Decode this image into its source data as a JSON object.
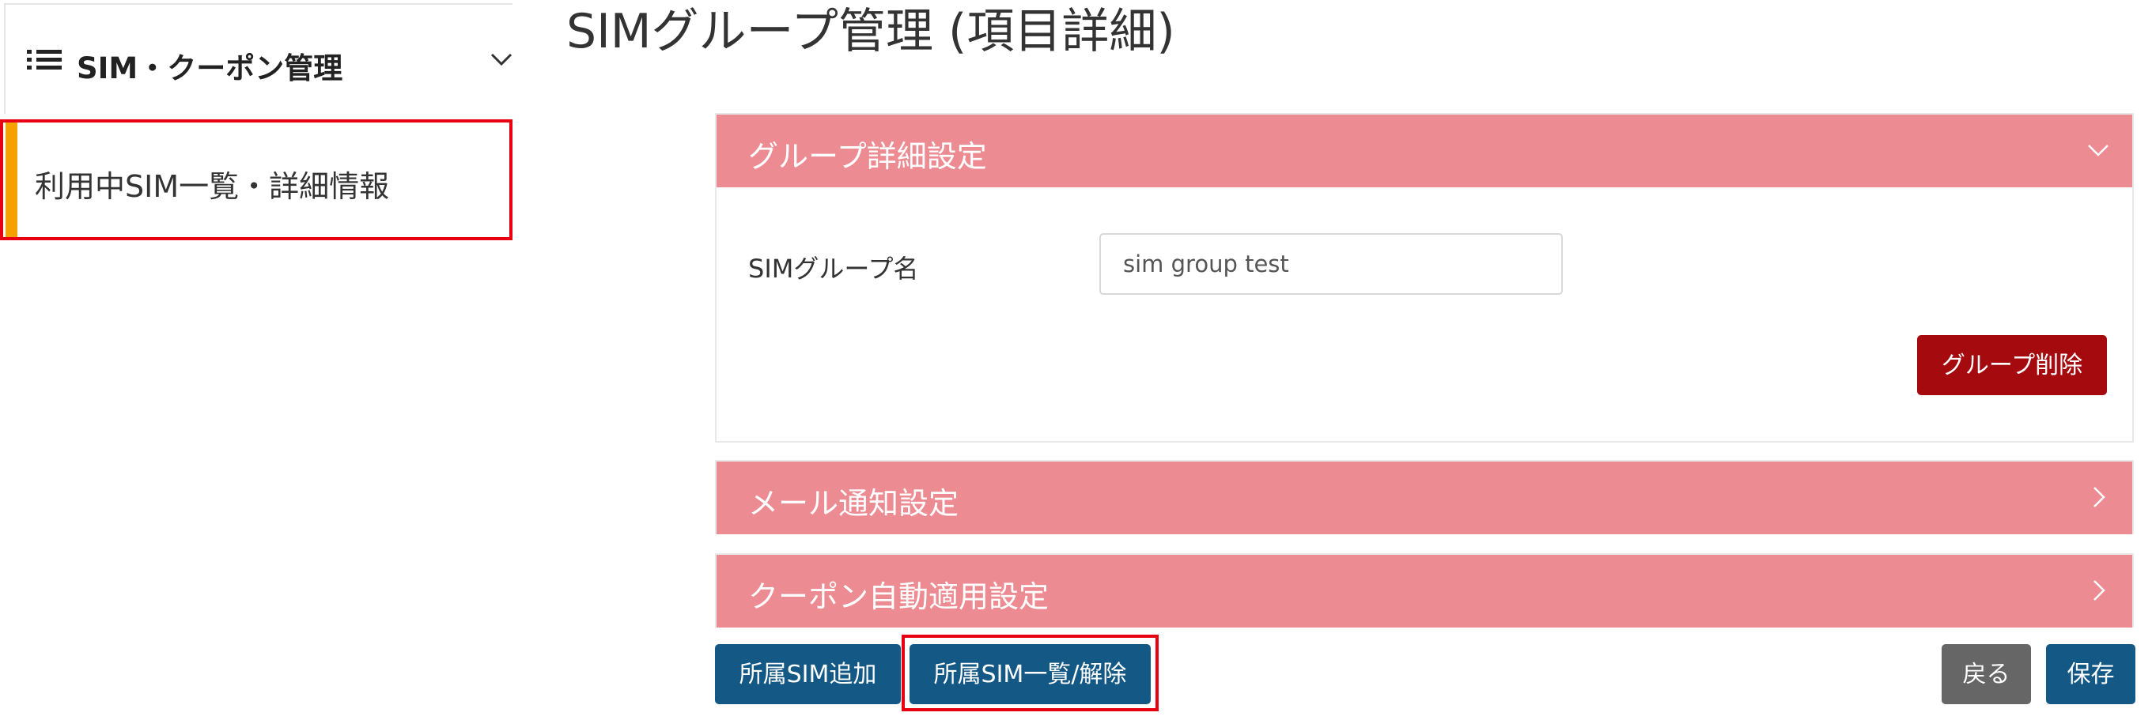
{
  "sidebar": {
    "title": "SIM・クーポン管理",
    "icon": "list-icon",
    "chevron": "chevron-down-icon",
    "items": [
      {
        "label": "利用中SIM一覧・詳細情報",
        "accent_color": "#f5a200"
      }
    ]
  },
  "page": {
    "title": "SIMグループ管理 (項目詳細)"
  },
  "panels": [
    {
      "title": "グループ詳細設定",
      "expanded": true,
      "chevron": "chevron-down-icon"
    },
    {
      "title": "メール通知設定",
      "expanded": false,
      "chevron": "chevron-right-icon"
    },
    {
      "title": "クーポン自動適用設定",
      "expanded": false,
      "chevron": "chevron-right-icon"
    }
  ],
  "group_detail": {
    "name_label": "SIMグループ名",
    "name_value": "sim group test",
    "delete_button": "グループ削除"
  },
  "actions": {
    "add_sim": "所属SIM追加",
    "list_remove_sim": "所属SIM一覧/解除",
    "back": "戻る",
    "save": "保存"
  },
  "colors": {
    "panel_header": "#ec8b91",
    "primary_button": "#145885",
    "danger_button": "#a50a0e",
    "secondary_button": "#666666",
    "highlight_border": "#e60012"
  }
}
